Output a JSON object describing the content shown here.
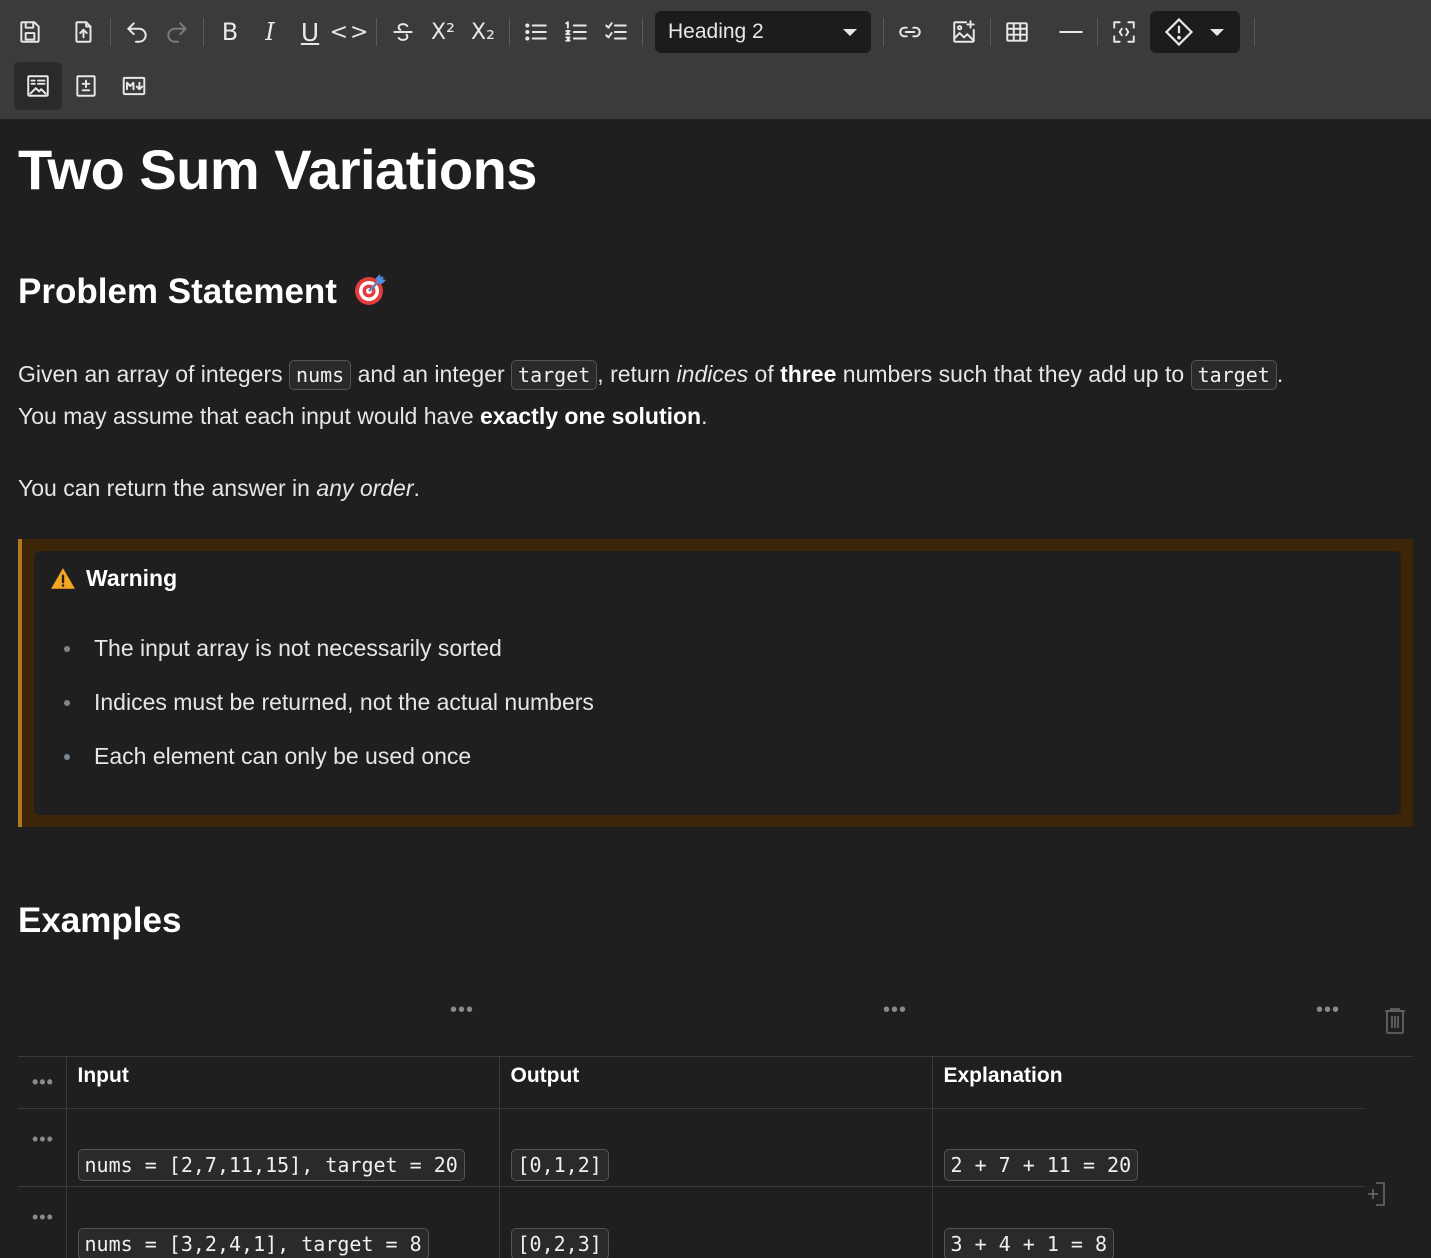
{
  "toolbar": {
    "heading_select": "Heading 2",
    "buttons": [
      "save",
      "export",
      "undo",
      "redo",
      "bold",
      "italic",
      "underline",
      "code",
      "strikethrough",
      "superscript",
      "subscript",
      "bullet-list",
      "numbered-list",
      "task-list",
      "link",
      "image",
      "table",
      "horizontal-rule",
      "fullscreen",
      "callout",
      "wysiwyg",
      "diff",
      "markdown"
    ],
    "bold_glyph": "B",
    "italic_glyph": "I",
    "underline_glyph": "U",
    "code_glyph": "<>",
    "sup_glyph": "X²",
    "sub_glyph": "X₂"
  },
  "doc": {
    "title": "Two Sum Variations",
    "problem_heading": "Problem Statement",
    "p1": {
      "t1": "Given an array of integers ",
      "c1": "nums",
      "t2": " and an integer ",
      "c2": "target",
      "t3": ", return ",
      "i1": "indices",
      "t4": " of ",
      "b1": "three",
      "t5": " numbers such that they add up to ",
      "c3": "target",
      "t6": "."
    },
    "p2": {
      "t1": "You may assume that each input would have ",
      "b1": "exactly one solution",
      "t2": "."
    },
    "p3": {
      "t1": "You can return the answer in ",
      "i1": "any order",
      "t2": "."
    },
    "callout": {
      "title": "Warning",
      "items": [
        "The input array is not necessarily sorted",
        "Indices must be returned, not the actual numbers",
        "Each element can only be used once"
      ]
    },
    "examples_heading": "Examples",
    "table": {
      "headers": [
        "Input",
        "Output",
        "Explanation"
      ],
      "rows": [
        [
          "nums = [2,7,11,15], target = 20",
          "[0,1,2]",
          "2 + 7 + 11 = 20"
        ],
        [
          "nums = [3,2,4,1], target = 8",
          "[0,2,3]",
          "3 + 4 + 1 = 8"
        ]
      ]
    }
  },
  "colors": {
    "toolbar_bg": "#3b3b3b",
    "editor_bg": "#1f1f1f",
    "warning_border": "#b07a1e",
    "warning_bg": "#3d2608"
  }
}
